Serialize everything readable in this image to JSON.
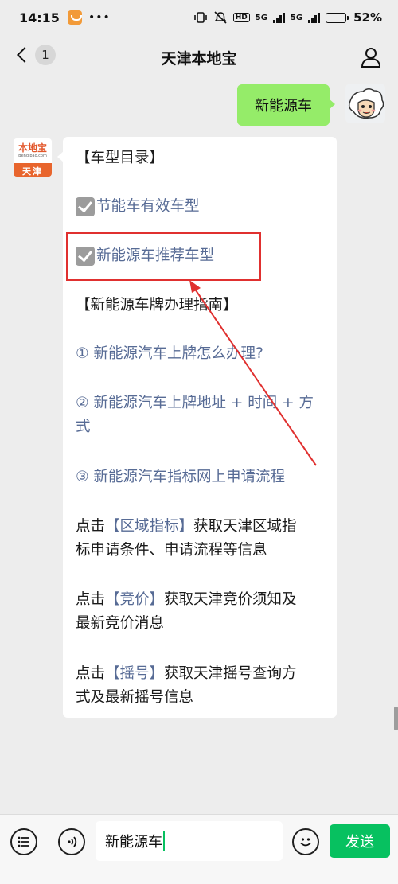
{
  "status_bar": {
    "time": "14:15",
    "dots": "•••",
    "hd": "HD",
    "net1": "5G",
    "net2": "5G",
    "battery_pct": "52%",
    "battery_level": 0.52
  },
  "header": {
    "back_badge": "1",
    "title": "天津本地宝"
  },
  "chat": {
    "outgoing_message": "新能源车",
    "bot_avatar": {
      "logo": "本地宝",
      "logo_sub": "Bendibao.com",
      "city": "天津"
    },
    "reply": {
      "section1_title": "【车型目录】",
      "item1": "节能车有效车型",
      "item2": "新能源车推荐车型",
      "section2_title": "【新能源车牌办理指南】",
      "link1": "① 新能源汽车上牌怎么办理?",
      "link2_line1": "② 新能源汽车上牌地址 + 时间 + 方",
      "link2_line2": "式",
      "link3": "③ 新能源汽车指标网上申请流程",
      "p1": {
        "prefix": " 点击",
        "kw": "【区域指标】",
        "line1_suffix": "获取天津区域指",
        "line2": "标申请条件、申请流程等信息"
      },
      "p2": {
        "prefix": " 点击",
        "kw": "【竞价】",
        "line1_suffix": "获取天津竞价须知及",
        "line2": "最新竞价消息"
      },
      "p3": {
        "prefix": "点击",
        "kw": "【摇号】",
        "line1_suffix": "获取天津摇号查询方",
        "line2": "式及最新摇号信息"
      }
    }
  },
  "input_bar": {
    "value": "新能源车",
    "send_label": "发送"
  },
  "colors": {
    "outgoing_bubble": "#95ec69",
    "link": "#576b95",
    "highlight": "#e0302f",
    "send": "#07c160"
  },
  "icons": [
    "back-chevron-icon",
    "profile-icon",
    "menu-list-icon",
    "voice-icon",
    "emoji-icon",
    "checkbox-icon"
  ]
}
